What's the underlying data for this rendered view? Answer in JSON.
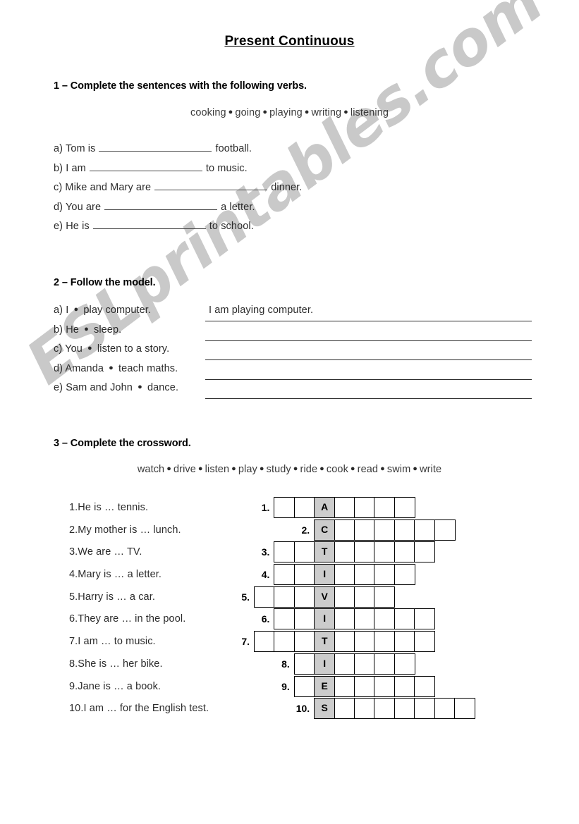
{
  "document": {
    "title": "Present Continuous",
    "watermark": "ESLprintables.com"
  },
  "exercise1": {
    "heading": "1 – Complete the sentences with the following verbs.",
    "wordbank": [
      "cooking",
      "going",
      "playing",
      "writing",
      "listening"
    ],
    "separator": "●",
    "items": [
      {
        "label": "a)",
        "before": "Tom is",
        "after": "football.",
        "blank_width": 160
      },
      {
        "label": "b)",
        "before": "I am",
        "after": "to music.",
        "blank_width": 160
      },
      {
        "label": "c)",
        "before": "Mike and Mary are",
        "after": "dinner.",
        "blank_width": 160
      },
      {
        "label": "d)",
        "before": "You are",
        "after": "a letter.",
        "blank_width": 160
      },
      {
        "label": "e)",
        "before": "He is",
        "after": "to school.",
        "blank_width": 160
      }
    ]
  },
  "exercise2": {
    "heading": "2 – Follow the model.",
    "items": [
      {
        "label": "a)",
        "subject": "I",
        "bullet": "●",
        "verb": "play computer.",
        "answer": "I am playing computer."
      },
      {
        "label": "b)",
        "subject": "He",
        "bullet": "●",
        "verb": "sleep.",
        "answer": ""
      },
      {
        "label": "c)",
        "subject": "You",
        "bullet": "●",
        "verb": "listen to a story.",
        "answer": ""
      },
      {
        "label": "d)",
        "subject": "Amanda",
        "bullet": "●",
        "verb": "teach maths.",
        "answer": ""
      },
      {
        "label": "e)",
        "subject": "Sam and John",
        "bullet": "●",
        "verb": "dance.",
        "answer": ""
      }
    ]
  },
  "exercise3": {
    "heading": "3 – Complete the crossword.",
    "wordbank": [
      "watch",
      "drive",
      "listen",
      "play",
      "study",
      "ride",
      "cook",
      "read",
      "swim",
      "write"
    ],
    "separator": "●",
    "clues": [
      {
        "num": "1.",
        "text": "He is … tennis."
      },
      {
        "num": "2.",
        "text": "My mother is … lunch."
      },
      {
        "num": "3.",
        "text": "We are … TV."
      },
      {
        "num": "4.",
        "text": "Mary is … a letter."
      },
      {
        "num": "5.",
        "text": "Harry is … a car."
      },
      {
        "num": "6.",
        "text": "They are … in the pool."
      },
      {
        "num": "7.",
        "text": "I am … to music."
      },
      {
        "num": "8.",
        "text": "She is … her bike."
      },
      {
        "num": "9.",
        "text": "Jane is … a book."
      },
      {
        "num": "10.",
        "text": "I am …  for the English test."
      }
    ],
    "grid": {
      "shaded_word": "ACTIVITIES",
      "shaded_column_index": 3,
      "rows": [
        {
          "num": "1.",
          "left_cells": 2,
          "letter": "A",
          "right_cells": 4
        },
        {
          "num": "2.",
          "left_cells": 0,
          "letter": "C",
          "right_cells": 6
        },
        {
          "num": "3.",
          "left_cells": 2,
          "letter": "T",
          "right_cells": 5
        },
        {
          "num": "4.",
          "left_cells": 2,
          "letter": "I",
          "right_cells": 4
        },
        {
          "num": "5.",
          "left_cells": 3,
          "letter": "V",
          "right_cells": 3
        },
        {
          "num": "6.",
          "left_cells": 2,
          "letter": "I",
          "right_cells": 5
        },
        {
          "num": "7.",
          "left_cells": 3,
          "letter": "T",
          "right_cells": 5
        },
        {
          "num": "8.",
          "left_cells": 1,
          "letter": "I",
          "right_cells": 4
        },
        {
          "num": "9.",
          "left_cells": 1,
          "letter": "E",
          "right_cells": 5
        },
        {
          "num": "10.",
          "left_cells": 0,
          "letter": "S",
          "right_cells": 7
        }
      ]
    }
  }
}
